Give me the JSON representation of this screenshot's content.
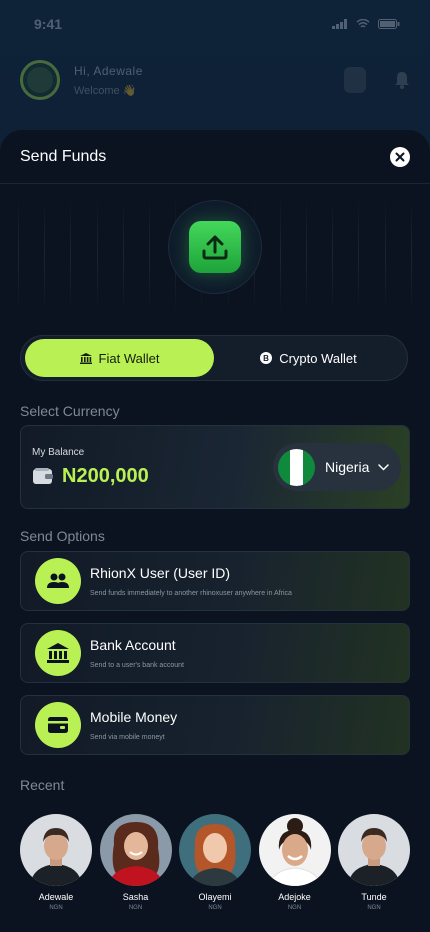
{
  "status_bar": {
    "time": "9:41"
  },
  "background_header": {
    "greeting": "Hi, Adewale",
    "subtitle": "Welcome 👋"
  },
  "sheet": {
    "title": "Send Funds"
  },
  "wallet_toggle": {
    "tabs": [
      {
        "label": "Fiat Wallet",
        "active": true,
        "icon": "bank-icon"
      },
      {
        "label": "Crypto Wallet",
        "active": false,
        "icon": "bitcoin-icon"
      }
    ]
  },
  "select_currency": {
    "label": "Select Currency",
    "balance_label": "My Balance",
    "balance_amount": "N200,000",
    "currency": "Nigeria"
  },
  "send_options": {
    "label": "Send Options",
    "items": [
      {
        "title": "RhionX User (User ID)",
        "subtitle": "Send funds immediately to another rhinoxuser anywhere in Africa",
        "icon": "users-icon"
      },
      {
        "title": "Bank Account",
        "subtitle": "Send to a user's bank account",
        "icon": "bank-icon"
      },
      {
        "title": "Mobile Money",
        "subtitle": "Send via mobile moneyt",
        "icon": "wallet-icon"
      }
    ]
  },
  "recent": {
    "label": "Recent",
    "contacts": [
      {
        "name": "Adewale",
        "currency": "NGN"
      },
      {
        "name": "Sasha",
        "currency": "NGN"
      },
      {
        "name": "Olayemi",
        "currency": "NGN"
      },
      {
        "name": "Adejoke",
        "currency": "NGN"
      },
      {
        "name": "Tunde",
        "currency": "NGN"
      }
    ]
  },
  "colors": {
    "accent": "#b9f155",
    "sheet_bg": "#0b1320",
    "flag_green": "#0f8a3c",
    "flag_white": "#ffffff"
  }
}
